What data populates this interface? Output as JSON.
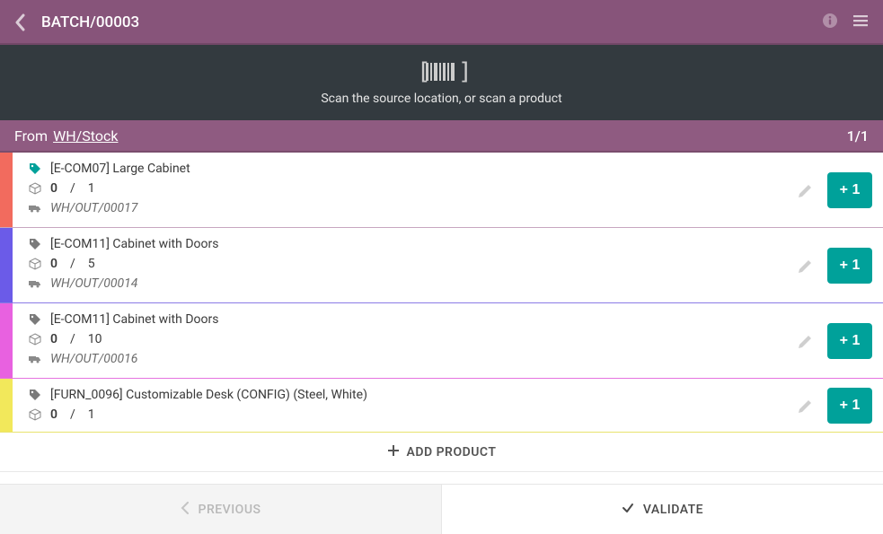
{
  "header": {
    "title": "BATCH/00003"
  },
  "scan": {
    "text": "Scan the source location, or scan a product"
  },
  "from": {
    "label": "From",
    "location": "WH/Stock",
    "pager": "1/1"
  },
  "lines": [
    {
      "color": "#f26b5e",
      "name": "[E-COM07] Large Cabinet",
      "done": "0",
      "total": "1",
      "picking": "WH/OUT/00017",
      "plus": "+ 1",
      "tag_color": "#00a19a"
    },
    {
      "color": "#6b5be8",
      "name": "[E-COM11] Cabinet with Doors",
      "done": "0",
      "total": "5",
      "picking": "WH/OUT/00014",
      "plus": "+ 1",
      "tag_color": "#7a7a7a"
    },
    {
      "color": "#e861e0",
      "name": "[E-COM11] Cabinet with Doors",
      "done": "0",
      "total": "10",
      "picking": "WH/OUT/00016",
      "plus": "+ 1",
      "tag_color": "#7a7a7a"
    },
    {
      "color": "#f2e85b",
      "name": "[FURN_0096] Customizable Desk (CONFIG) (Steel, White)",
      "done": "0",
      "total": "1",
      "picking": "",
      "plus": "+ 1",
      "tag_color": "#7a7a7a"
    }
  ],
  "buttons": {
    "add_product": "ADD PRODUCT",
    "previous": "PREVIOUS",
    "validate": "VALIDATE"
  }
}
